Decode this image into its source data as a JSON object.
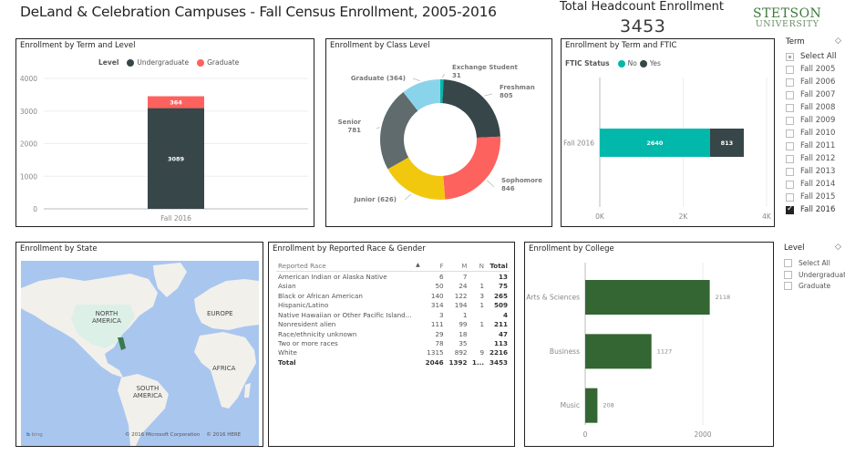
{
  "header": {
    "title": "DeLand & Celebration Campuses - Fall Census Enrollment, 2005-2016",
    "kpi_label": "Total Headcount Enrollment",
    "kpi_value": "3453",
    "logo_line1": "STETSON",
    "logo_line2": "UNIVERSITY",
    "brand_color": "#3b7a3b"
  },
  "panels": {
    "term_level": "Enrollment by Term and Level",
    "class_level": "Enrollment by Class Level",
    "term_ftic": "Enrollment by Term and FTIC",
    "state": "Enrollment by State",
    "race_gender": "Enrollment by Reported Race & Gender",
    "college": "Enrollment by College"
  },
  "chart_data": [
    {
      "id": "term_level",
      "type": "bar",
      "stacked": true,
      "title": "Enrollment by Term and Level",
      "legend_title": "Level",
      "legend_position": "top",
      "categories": [
        "Fall 2016"
      ],
      "series": [
        {
          "name": "Undergraduate",
          "values": [
            3089
          ],
          "color": "#374649"
        },
        {
          "name": "Graduate",
          "values": [
            364
          ],
          "color": "#fd625e"
        }
      ],
      "yticks": [
        "0",
        "1000",
        "2000",
        "3000",
        "4000"
      ],
      "ylim": [
        0,
        4000
      ],
      "grid": true
    },
    {
      "id": "class_level",
      "type": "pie",
      "donut": true,
      "title": "Enrollment by Class Level",
      "slices": [
        {
          "name": "Exchange Student",
          "value": 31,
          "label": "Exchange Student\n31",
          "color": "#01b8aa"
        },
        {
          "name": "Freshman",
          "value": 805,
          "label": "Freshman\n805",
          "color": "#374649"
        },
        {
          "name": "Sophomore",
          "value": 846,
          "label": "Sophomore\n846",
          "color": "#fd625e"
        },
        {
          "name": "Junior",
          "value": 626,
          "label": "Junior (626)",
          "color": "#f2c80f"
        },
        {
          "name": "Senior",
          "value": 781,
          "label": "Senior\n781",
          "color": "#5f6b6d"
        },
        {
          "name": "Graduate",
          "value": 364,
          "label": "Graduate (364)",
          "color": "#8ad4eb"
        }
      ]
    },
    {
      "id": "term_ftic",
      "type": "bar",
      "orientation": "horizontal",
      "stacked": true,
      "title": "Enrollment by Term and FTIC",
      "legend_title": "FTIC Status",
      "legend_position": "top-left",
      "categories": [
        "Fall 2016"
      ],
      "series": [
        {
          "name": "No",
          "values": [
            2640
          ],
          "color": "#01b8aa"
        },
        {
          "name": "Yes",
          "values": [
            813
          ],
          "color": "#374649"
        }
      ],
      "xticks": [
        "0K",
        "2K",
        "4K"
      ],
      "xlim": [
        0,
        4000
      ],
      "grid": true
    },
    {
      "id": "college",
      "type": "bar",
      "orientation": "horizontal",
      "title": "Enrollment by College",
      "categories": [
        "Arts & Sciences",
        "Business",
        "Music"
      ],
      "values": [
        2118,
        1127,
        208
      ],
      "color": "#336633",
      "xticks": [
        "0",
        "2000"
      ],
      "xlim": [
        0,
        3200
      ],
      "grid": true
    }
  ],
  "map": {
    "labels": [
      "NORTH\nAMERICA",
      "EUROPE",
      "AFRICA",
      "SOUTH\nAMERICA"
    ],
    "bing": "bing",
    "copyright": "© 2016 Microsoft Corporation    © 2016 HERE"
  },
  "race_table": {
    "headers": [
      "Reported Race",
      "F",
      "M",
      "N",
      "Total"
    ],
    "rows": [
      [
        "American Indian or Alaska Native",
        "6",
        "7",
        "",
        "13"
      ],
      [
        "Asian",
        "50",
        "24",
        "1",
        "75"
      ],
      [
        "Black or African American",
        "140",
        "122",
        "3",
        "265"
      ],
      [
        "Hispanic/Latino",
        "314",
        "194",
        "1",
        "509"
      ],
      [
        "Native Hawaiian or Other Pacific Island...",
        "3",
        "1",
        "",
        "4"
      ],
      [
        "Nonresident alien",
        "111",
        "99",
        "1",
        "211"
      ],
      [
        "Race/ethnicity unknown",
        "29",
        "18",
        "",
        "47"
      ],
      [
        "Two or more races",
        "78",
        "35",
        "",
        "113"
      ],
      [
        "White",
        "1315",
        "892",
        "9",
        "2216"
      ]
    ],
    "total": [
      "Total",
      "2046",
      "1392",
      "1...",
      "3453"
    ]
  },
  "term_slicer": {
    "title": "Term",
    "items": [
      {
        "label": "Select All",
        "state": "partial"
      },
      {
        "label": "Fall 2005",
        "state": "off"
      },
      {
        "label": "Fall 2006",
        "state": "off"
      },
      {
        "label": "Fall 2007",
        "state": "off"
      },
      {
        "label": "Fall 2008",
        "state": "off"
      },
      {
        "label": "Fall 2009",
        "state": "off"
      },
      {
        "label": "Fall 2010",
        "state": "off"
      },
      {
        "label": "Fall 2011",
        "state": "off"
      },
      {
        "label": "Fall 2012",
        "state": "off"
      },
      {
        "label": "Fall 2013",
        "state": "off"
      },
      {
        "label": "Fall 2014",
        "state": "off"
      },
      {
        "label": "Fall 2015",
        "state": "off"
      },
      {
        "label": "Fall 2016",
        "state": "checked"
      }
    ]
  },
  "level_slicer": {
    "title": "Level",
    "items": [
      {
        "label": "Select All",
        "state": "off"
      },
      {
        "label": "Undergraduate",
        "state": "off"
      },
      {
        "label": "Graduate",
        "state": "off"
      }
    ]
  }
}
